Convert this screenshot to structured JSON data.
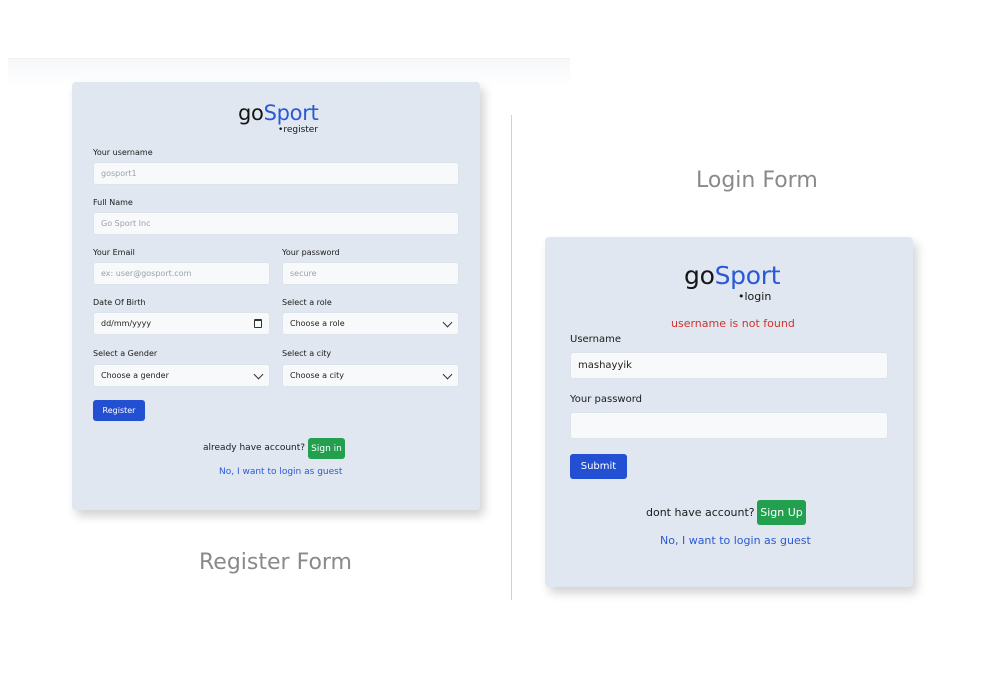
{
  "register": {
    "caption": "Register Form",
    "brand_go": "go",
    "brand_sport": "Sport",
    "brand_sub": "register",
    "username_label": "Your username",
    "username_placeholder": "gosport1",
    "fullname_label": "Full Name",
    "fullname_placeholder": "Go Sport Inc",
    "email_label": "Your Email",
    "email_placeholder": "ex: user@gosport.com",
    "password_label": "Your password",
    "password_placeholder": "secure",
    "dob_label": "Date Of Birth",
    "dob_value": "dd/mm/yyyy",
    "role_label": "Select a role",
    "role_value": "Choose a role",
    "gender_label": "Select a Gender",
    "gender_value": "Choose a gender",
    "city_label": "Select a city",
    "city_value": "Choose a city",
    "register_button": "Register",
    "have_account_text": "already have account?",
    "signin_button": "Sign in",
    "guest_link": "No, I want to login as guest"
  },
  "login": {
    "caption": "Login Form",
    "brand_go": "go",
    "brand_sport": "Sport",
    "brand_sub": "login",
    "error_message": "username is not found",
    "username_label": "Username",
    "username_value": "mashayyik",
    "password_label": "Your password",
    "password_value": "",
    "submit_button": "Submit",
    "no_account_text": "dont have account?",
    "signup_button": "Sign Up",
    "guest_link": "No, I want to login as guest"
  },
  "colors": {
    "card_bg": "#e0e7f0",
    "brand_blue": "#2b59d6",
    "button_blue": "#2350d2",
    "button_green": "#22a050",
    "error_red": "#d2312b"
  }
}
